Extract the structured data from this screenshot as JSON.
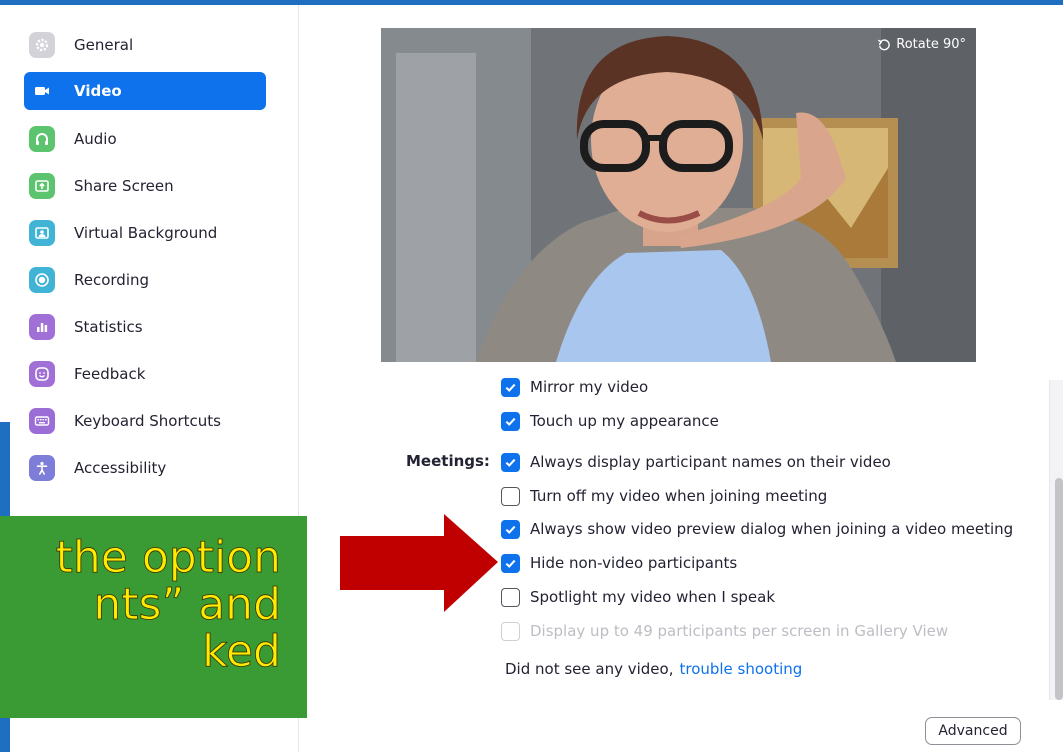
{
  "colors": {
    "accent": "#0e72ed",
    "top_bar": "#1e6fc2",
    "callout_bg": "#3a9b35",
    "callout_text": "#ffea00",
    "arrow": "#c00000",
    "link": "#0e72ed"
  },
  "sidebar": {
    "items": [
      {
        "label": "General",
        "icon": "gear-icon",
        "icon_color": "#d2d2d8",
        "active": false
      },
      {
        "label": "Video",
        "icon": "video-camera-icon",
        "icon_color": "#0e72ed",
        "active": true
      },
      {
        "label": "Audio",
        "icon": "headphones-icon",
        "icon_color": "#5cc36e",
        "active": false
      },
      {
        "label": "Share Screen",
        "icon": "share-screen-icon",
        "icon_color": "#5cc36e",
        "active": false
      },
      {
        "label": "Virtual Background",
        "icon": "virtual-background-icon",
        "icon_color": "#41b4d6",
        "active": false
      },
      {
        "label": "Recording",
        "icon": "recording-icon",
        "icon_color": "#41b4d6",
        "active": false
      },
      {
        "label": "Statistics",
        "icon": "statistics-icon",
        "icon_color": "#a070d6",
        "active": false
      },
      {
        "label": "Feedback",
        "icon": "feedback-smiley-icon",
        "icon_color": "#a070d6",
        "active": false
      },
      {
        "label": "Keyboard Shortcuts",
        "icon": "keyboard-icon",
        "icon_color": "#9a6ed6",
        "active": false
      },
      {
        "label": "Accessibility",
        "icon": "accessibility-icon",
        "icon_color": "#7e7ed8",
        "active": false
      }
    ]
  },
  "preview": {
    "rotate_label": "Rotate 90°"
  },
  "callout": {
    "text": " the option\nnts” and\nked"
  },
  "options": {
    "meetings_label": "Meetings:",
    "items": [
      {
        "label": "Mirror my video",
        "checked": true,
        "disabled": false
      },
      {
        "label": "Touch up my appearance",
        "checked": true,
        "disabled": false
      },
      {
        "label": "Always display participant names on their video",
        "checked": true,
        "disabled": false
      },
      {
        "label": "Turn off my video when joining meeting",
        "checked": false,
        "disabled": false
      },
      {
        "label": "Always show video preview dialog when joining a video meeting",
        "checked": true,
        "disabled": false
      },
      {
        "label": "Hide non-video participants",
        "checked": true,
        "disabled": false
      },
      {
        "label": "Spotlight my video when I speak",
        "checked": false,
        "disabled": false
      },
      {
        "label": "Display up to 49 participants per screen in Gallery View",
        "checked": false,
        "disabled": true
      }
    ]
  },
  "footer": {
    "trouble_text": "Did not see any video,",
    "trouble_link": "trouble shooting",
    "advanced_label": "Advanced"
  }
}
